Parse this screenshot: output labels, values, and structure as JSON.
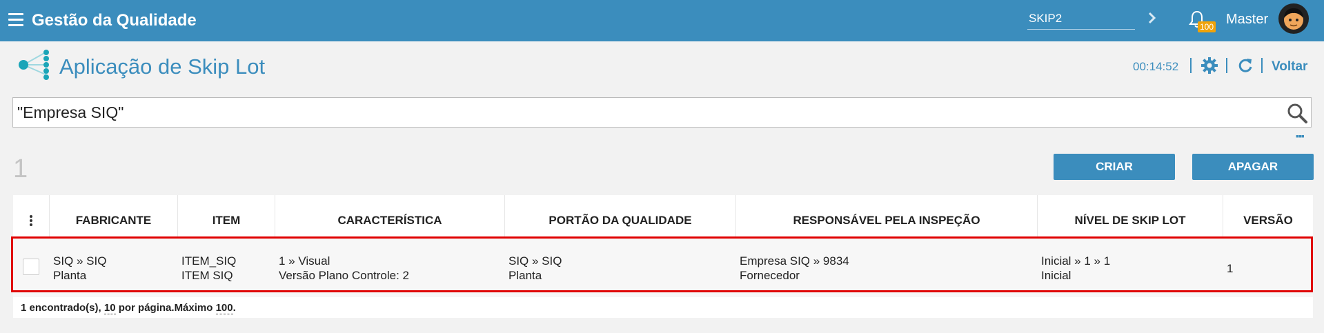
{
  "header": {
    "app_title": "Gestão da Qualidade",
    "search_value": "SKIP2",
    "notification_count": "100",
    "user_name": "Master"
  },
  "page": {
    "title": "Aplicação de Skip Lot",
    "timer": "00:14:52",
    "back_label": "Voltar"
  },
  "search": {
    "value": "\"Empresa SIQ\""
  },
  "toolbar": {
    "count": "1",
    "create_label": "CRIAR",
    "delete_label": "APAGAR"
  },
  "table": {
    "columns": [
      "FABRICANTE",
      "ITEM",
      "CARACTERÍSTICA",
      "PORTÃO DA QUALIDADE",
      "RESPONSÁVEL PELA INSPEÇÃO",
      "NÍVEL DE SKIP LOT",
      "VERSÃO"
    ],
    "rows": [
      {
        "fabricante": [
          "SIQ » SIQ",
          "Planta"
        ],
        "item": [
          "ITEM_SIQ",
          "ITEM SIQ"
        ],
        "caracteristica": [
          "1 » Visual",
          "Versão Plano Controle: 2"
        ],
        "portao": [
          "SIQ » SIQ",
          "Planta"
        ],
        "responsavel": [
          "Empresa SIQ » 9834",
          "Fornecedor"
        ],
        "nivel": [
          "Inicial » 1 » 1",
          "Inicial"
        ],
        "versao": "1"
      }
    ]
  },
  "footer": {
    "found_text": "1 encontrado(s), ",
    "page_size": "10",
    "per_page_text": " por página.",
    "max_label": "Máximo ",
    "max_value": "100",
    "end": "."
  },
  "colors": {
    "primary": "#3b8dbd",
    "badge": "#f0a30a",
    "highlight": "#e00000"
  }
}
